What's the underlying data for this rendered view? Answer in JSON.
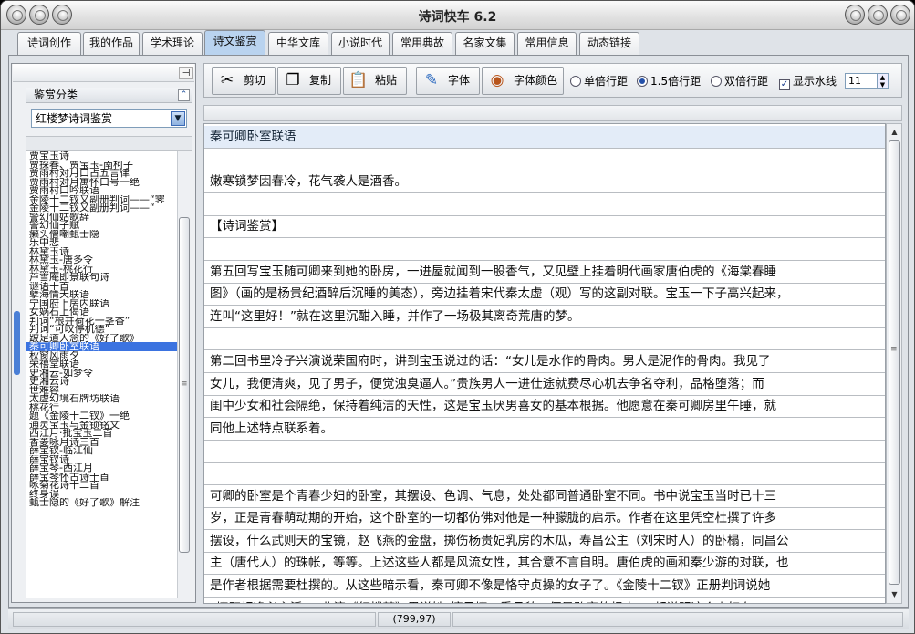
{
  "window": {
    "title": "诗词快车 6.2"
  },
  "tabs": [
    {
      "label": "诗词创作"
    },
    {
      "label": "我的作品"
    },
    {
      "label": "学术理论"
    },
    {
      "label": "诗文鉴赏",
      "active": true
    },
    {
      "label": "中华文库"
    },
    {
      "label": "小说时代"
    },
    {
      "label": "常用典故"
    },
    {
      "label": "名家文集"
    },
    {
      "label": "常用信息"
    },
    {
      "label": "动态链接"
    }
  ],
  "sidebar": {
    "section_title": "鉴赏分类",
    "category_value": "红楼梦诗词鉴赏",
    "items": [
      "贾宝玉诗",
      "贾探春、贾宝玉-南柯子",
      "贾雨村对月口占五言律",
      "贾雨村对月寓怀口号一绝",
      "贾雨村口吟联语",
      "金陵十二钗又副册判词——“霁",
      "金陵十二钗又副册判词——“",
      "警幻仙姑歌辞",
      "警幻仙子赋",
      "癞头僧嘲甄士隐",
      "乐中悲",
      "林黛玉诗",
      "林黛玉-唐多令",
      "林黛玉-桃花行",
      "芦雪庵即景联句诗",
      "谜语十首",
      "孽海情天联语",
      "宁国府上房内联语",
      "女娲石上偈语",
      "判词“根并荷花一茎香”",
      "判词“可叹停机德”",
      "跛足道人念的《好了歌》",
      "秦可卿卧室联语",
      "秋窗风雨夕",
      "荣禧堂联语",
      "史湘云-如梦令",
      "史湘云诗",
      "世难容",
      "太虚幻境石牌坊联语",
      "桃花行",
      "题《金陵十二钗》一绝",
      "通灵宝玉与金锁铭文",
      "西江月·批宝玉二首",
      "香菱咏月诗三首",
      "薛宝钗-临江仙",
      "薛宝钗诗",
      "薛宝琴-西江月",
      "薛宝琴怀古诗十首",
      "咏菊花诗十二首",
      "终身误",
      "甄士隐的《好了歌》解注"
    ],
    "selected_index": 22
  },
  "toolbar": {
    "cut_label": "剪切",
    "copy_label": "复制",
    "paste_label": "粘贴",
    "font_label": "字体",
    "font_color_label": "字体颜色",
    "spacing_single": "单倍行距",
    "spacing_onehalf": "1.5倍行距",
    "spacing_double": "双倍行距",
    "spacing_selected": "1.5倍行距",
    "watermark_label": "显示水线",
    "watermark_checked": true,
    "font_size_value": "11"
  },
  "editor": {
    "lines": [
      "秦可卿卧室联语",
      "",
      "嫩寒锁梦因春冷，花气袭人是酒香。",
      "",
      "【诗词鉴赏】",
      "",
      "第五回写宝玉随可卿来到她的卧房，一进屋就闻到一股香气，又见壁上挂着明代画家唐伯虎的《海棠春睡",
      "图》（画的是杨贵纪酒醉后沉睡的美态），旁边挂着宋代秦太虚（观）写的这副对联。宝玉一下子高兴起来，",
      "连叫“这里好！”就在这里沉酣入睡，并作了一场极其离奇荒唐的梦。",
      "",
      "第二回书里冷子兴演说荣国府时，讲到宝玉说过的话：“女儿是水作的骨肉。男人是泥作的骨肉。我见了",
      "女儿，我便清爽，见了男子，便觉浊臭逼人。”贵族男人一进仕途就费尽心机去争名夺利，品格堕落；而",
      "闺中少女和社会隔绝，保持着纯洁的天性，这是宝玉厌男喜女的基本根据。他愿意在秦可卿房里午睡，就",
      "同他上述特点联系着。",
      "",
      "",
      "可卿的卧室是个青春少妇的卧室，其摆设、色调、气息，处处都同普通卧室不同。书中说宝玉当时已十三",
      "岁，正是青春萌动期的开始，这个卧室的一切都仿佛对他是一种朦胧的启示。作者在这里凭空杜撰了许多",
      "摆设，什么武则天的宝镜，赵飞燕的金盘，掷伤杨贵妃乳房的木瓜，寿昌公主（刘宋时人）的卧榻，同昌公",
      "主（唐代人）的珠帐，等等。上述这些人都是风流女性，其合意不言自明。唐伯虎的画和秦少游的对联，也",
      "是作者根据需要杜撰的。从这些暗示看，秦可卿不像是恪守贞操的女子了。《金陵十二钗》正册判词说她",
      "“情既相逢必主淫”，曲演《红楼梦》里说她“擅风情、秉月貌，便是败家的根本”，都说明这个少妇在"
    ]
  },
  "status": {
    "coords": "(799,97)"
  }
}
